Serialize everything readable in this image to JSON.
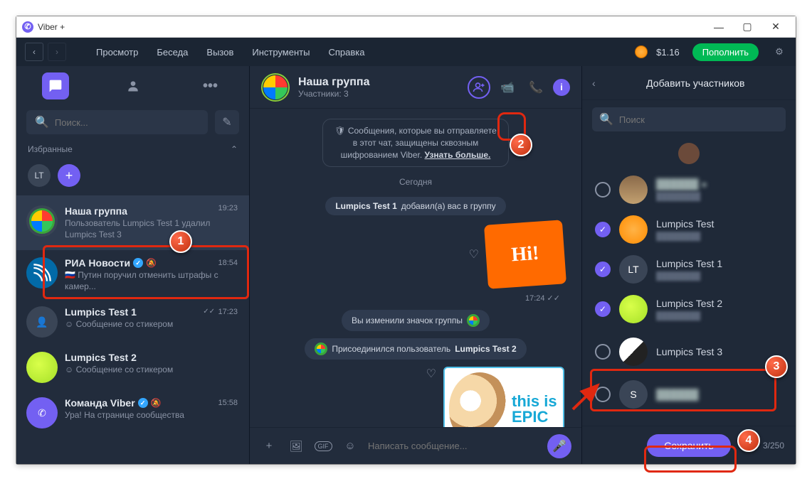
{
  "window": {
    "title": "Viber +"
  },
  "menu": {
    "items": [
      "Просмотр",
      "Беседа",
      "Вызов",
      "Инструменты",
      "Справка"
    ],
    "balance": "$1.16",
    "topup": "Пополнить"
  },
  "sidebar": {
    "search_placeholder": "Поиск...",
    "fav_label": "Избранные",
    "fav_chip": "LT",
    "chats": [
      {
        "title": "Наша группа",
        "time": "19:23",
        "sub": "Пользователь Lumpics Test 1 удалил Lumpics Test 3",
        "avatar": "colorwheel",
        "active": true
      },
      {
        "title": "РИА Новости",
        "time": "18:54",
        "sub": "🇷🇺 Путин поручил отменить штрафы с камер...",
        "avatar": "ria",
        "verified": true,
        "muted": true
      },
      {
        "title": "Lumpics Test 1",
        "time": "17:23",
        "sub": "☺ Сообщение со стикером",
        "avatar": "gray",
        "checks": true
      },
      {
        "title": "Lumpics Test 2",
        "time": "",
        "sub": "☺ Сообщение со стикером",
        "avatar": "lime"
      },
      {
        "title": "Команда Viber",
        "time": "15:58",
        "sub": "Ура! На странице сообщества",
        "avatar": "viber",
        "verified": true,
        "muted": true
      }
    ]
  },
  "chat": {
    "group_name": "Наша группа",
    "members_label": "Участники: 3",
    "encryption": {
      "line1": "🛡 Сообщения, которые вы отправляете",
      "line2": "в этот чат, защищены сквозным",
      "line3": "шифрованием Viber. ",
      "link": "Узнать больше."
    },
    "date": "Сегодня",
    "sys1_pre": "Lumpics Test 1",
    "sys1_post": " добавил(a) вас в группу",
    "sticker1": "Hi!",
    "time1": "17:24 ✓✓",
    "sys2": "Вы изменили значок группы",
    "sys3_pre": "Присоединился пользователь ",
    "sys3_post": "Lumpics Test 2",
    "epic_text": "this is EPIC",
    "input_placeholder": "Написать сообщение..."
  },
  "right": {
    "title": "Добавить участников",
    "search_placeholder": "Поиск",
    "items": [
      {
        "name": "",
        "avatar": "photo1",
        "selected": false,
        "blurred": true
      },
      {
        "name": "Lumpics Test",
        "avatar": "orange",
        "selected": true
      },
      {
        "name": "Lumpics Test 1",
        "avatar": "LT",
        "selected": true
      },
      {
        "name": "Lumpics Test 2",
        "avatar": "lime",
        "selected": true
      },
      {
        "name": "Lumpics Test 3",
        "avatar": "bw",
        "selected": false
      },
      {
        "name": "",
        "avatar": "S",
        "selected": false,
        "blurred": true
      }
    ],
    "save": "Сохранить",
    "count": "3/250"
  },
  "annotations": {
    "n1": "1",
    "n2": "2",
    "n3": "3",
    "n4": "4"
  }
}
